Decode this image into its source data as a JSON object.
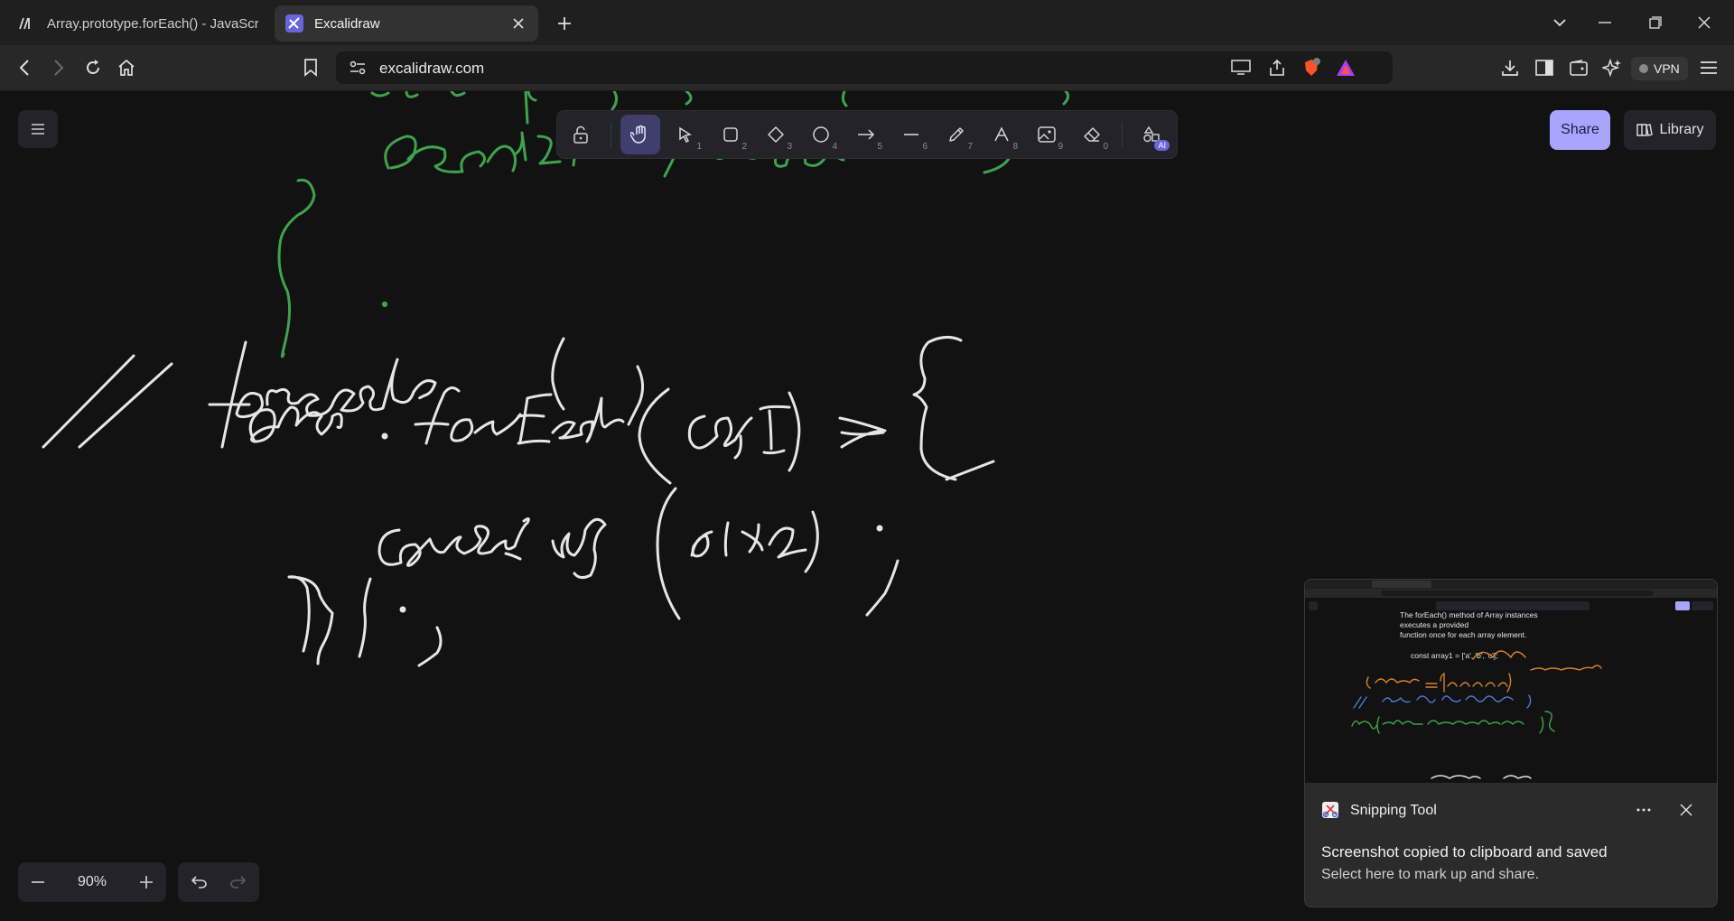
{
  "browser": {
    "tabs": [
      {
        "title": "Array.prototype.forEach() - JavaScript | MDN",
        "favicon": "mdn-icon",
        "active": false
      },
      {
        "title": "Excalidraw",
        "favicon": "excalidraw-icon",
        "active": true
      }
    ],
    "url": "excalidraw.com",
    "vpn_label": "VPN",
    "shields_count": "1"
  },
  "app": {
    "share_label": "Share",
    "library_label": "Library",
    "zoom_level": "90%",
    "tools": [
      {
        "name": "lock",
        "key": ""
      },
      {
        "name": "hand",
        "key": "",
        "active": true
      },
      {
        "name": "selection",
        "key": "1"
      },
      {
        "name": "rectangle",
        "key": "2"
      },
      {
        "name": "diamond",
        "key": "3"
      },
      {
        "name": "ellipse",
        "key": "4"
      },
      {
        "name": "arrow",
        "key": "5"
      },
      {
        "name": "line",
        "key": "6"
      },
      {
        "name": "draw",
        "key": "7"
      },
      {
        "name": "text",
        "key": "8"
      },
      {
        "name": "image",
        "key": "9"
      },
      {
        "name": "eraser",
        "key": "0"
      },
      {
        "name": "more-tools",
        "key": ""
      }
    ],
    "ai_badge": "AI",
    "accent_color": "#a8a5ff",
    "stroke_colors": {
      "green": "#3fa34d",
      "white": "#e6e6e6",
      "orange": "#d9822b",
      "blue": "#4a7bd6"
    }
  },
  "toast": {
    "app_name": "Snipping Tool",
    "message": "Screenshot copied to clipboard and saved",
    "sub": "Select here to mark up and share.",
    "preview_text": [
      "The forEach() method of Array instances",
      "executes a provided",
      "function once for each array element.",
      "const array1 = ['a', 'b', 'c'];"
    ]
  }
}
